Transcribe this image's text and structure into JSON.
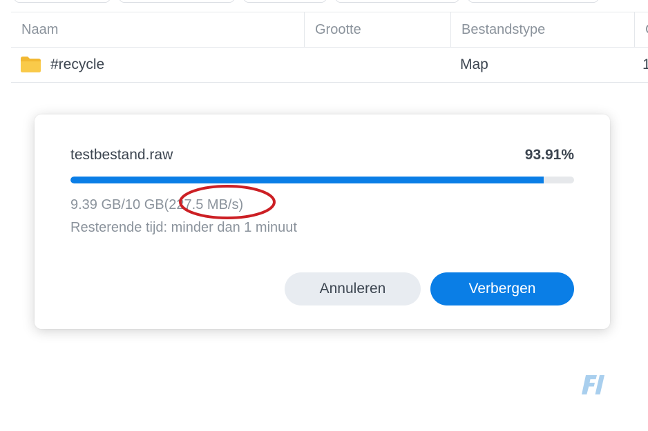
{
  "table": {
    "columns": [
      "Naam",
      "Grootte",
      "Bestandstype",
      "G"
    ],
    "rows": [
      {
        "name": "#recycle",
        "size": "",
        "type": "Map",
        "extra": "1"
      }
    ]
  },
  "dialog": {
    "filename": "testbestand.raw",
    "percent_text": "93.91%",
    "progress": 0.9391,
    "transfer_prefix": "9.39 GB/10 GB",
    "speed": "(227.5 MB/s)",
    "remaining": "Resterende tijd: minder dan 1 minuut",
    "cancel_label": "Annuleren",
    "hide_label": "Verbergen"
  },
  "colors": {
    "accent": "#0a7ee6",
    "annotation": "#cc1f24",
    "folder": "#f7c53f",
    "watermark": "#a9cfee"
  },
  "icons": {
    "folder": "folder-icon",
    "annotation": "red-ellipse-annotation",
    "watermark": "fi-logo"
  }
}
